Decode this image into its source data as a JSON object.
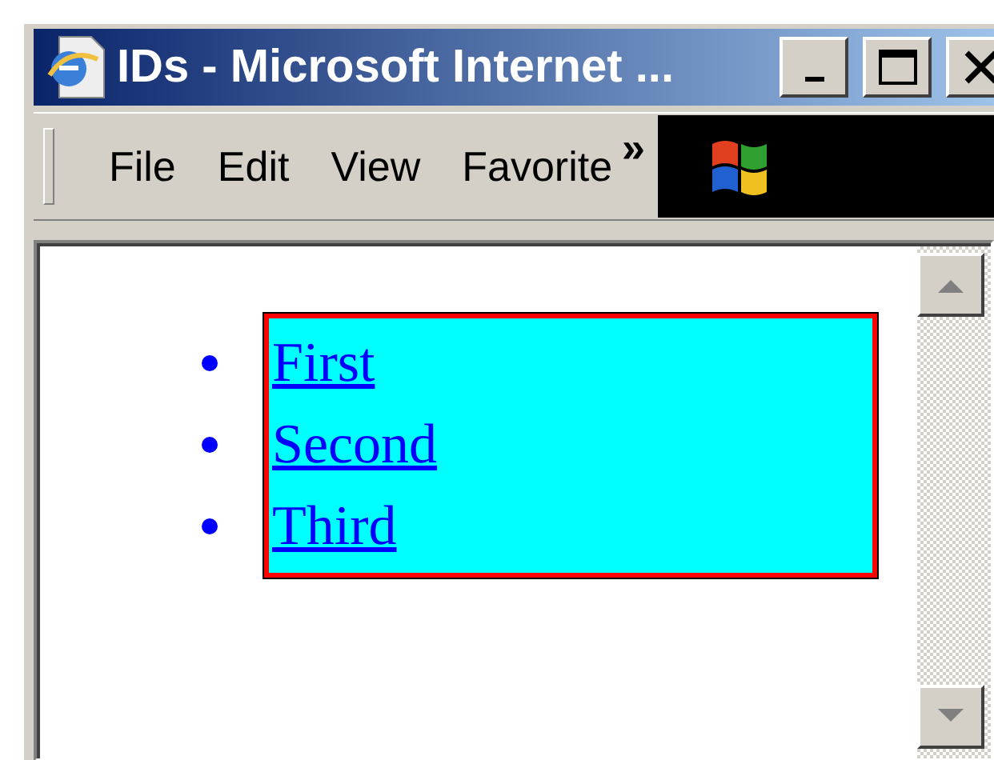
{
  "window": {
    "title": "IDs - Microsoft Internet ..."
  },
  "menu": [
    {
      "label": "File"
    },
    {
      "label": "Edit"
    },
    {
      "label": "View"
    },
    {
      "label": "Favorite"
    }
  ],
  "menu_overflow": "»",
  "links": [
    {
      "text": "First"
    },
    {
      "text": "Second"
    },
    {
      "text": "Third"
    }
  ]
}
